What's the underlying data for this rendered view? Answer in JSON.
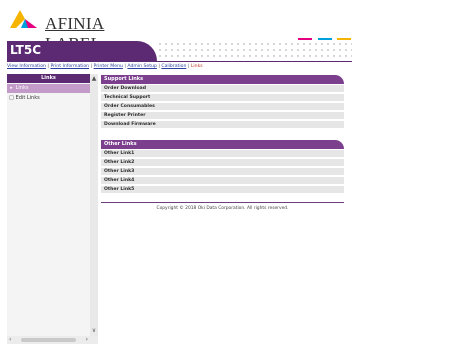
{
  "brand": {
    "logo_text": "AFINIA LABEL",
    "logo_icon": "afinia-triangle-logo",
    "accent": "#5b2a72"
  },
  "model": "LT5C",
  "breadcrumb": [
    {
      "label": "View Information",
      "current": false
    },
    {
      "label": "Print Information",
      "current": false
    },
    {
      "label": "Printer Menu",
      "current": false
    },
    {
      "label": "Admin Setup",
      "current": false
    },
    {
      "label": "Calibration",
      "current": false
    },
    {
      "label": "Links",
      "current": true
    }
  ],
  "sidebar": {
    "header": "Links",
    "items": [
      {
        "label": "Links",
        "icon": "bullet-icon",
        "selected": true
      },
      {
        "label": "Edit Links",
        "icon": "edit-icon",
        "selected": false
      }
    ]
  },
  "support_links": {
    "header": "Support Links",
    "items": [
      "Order Download",
      "Technical Support",
      "Order Consumables",
      "Register Printer",
      "Download Firmware"
    ]
  },
  "other_links": {
    "header": "Other Links",
    "items": [
      "Other Link1",
      "Other Link2",
      "Other Link3",
      "Other Link4",
      "Other Link5"
    ]
  },
  "footer": {
    "copyright": "Copyright © 2018 Oki Data Corporation. All rights reserved."
  }
}
